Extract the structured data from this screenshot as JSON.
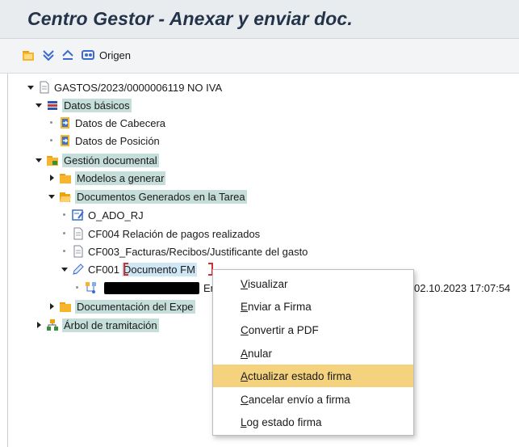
{
  "header": {
    "title": "Centro Gestor - Anexar y enviar doc."
  },
  "toolbar": {
    "origin_label": "Origen"
  },
  "tree": {
    "root": "GASTOS/2023/0000006119 NO IVA",
    "datos_basicos": "Datos básicos",
    "datos_cabecera": "Datos de Cabecera",
    "datos_posicion": "Datos de Posición",
    "gestion_documental": "Gestión documental",
    "modelos": "Modelos a generar",
    "documentos_generados": "Documentos Generados en la Tarea",
    "o_ado": "O_ADO_RJ",
    "cf004": "CF004 Relación de pagos realizados",
    "cf003": "CF003_Facturas/Recibos/Justificante del gasto",
    "cf001_code": "CF001",
    "cf001_name": "Documento FM",
    "child_prefix": "En",
    "child_date": "02.10.2023 17:07:54",
    "documentacion": "Documentación del Expe",
    "arbol": "Árbol de tramitación"
  },
  "context_menu": {
    "items": [
      {
        "first": "V",
        "rest": "isualizar"
      },
      {
        "first": "E",
        "rest": "nviar a Firma"
      },
      {
        "first": "C",
        "rest": "onvertir a PDF"
      },
      {
        "first": "A",
        "rest": "nular"
      },
      {
        "first": "A",
        "rest": "ctualizar estado firma"
      },
      {
        "first": "C",
        "rest": "ancelar envío a firma"
      },
      {
        "first": "L",
        "rest": "og estado firma"
      }
    ],
    "active_index": 4
  },
  "colors": {
    "highlight_node": "#c5ded9",
    "menu_active": "#f5d37e",
    "title": "#233349",
    "focus_mark": "#d32f2f"
  },
  "icons": [
    "folder-orange-icon",
    "expand-all-icon",
    "collapse-all-icon",
    "origin-icon",
    "document-icon",
    "stack-icon",
    "doc-arrow-icon",
    "folder-icon",
    "open-folder-icon",
    "edit-doc-icon",
    "pen-icon",
    "user-tree-icon"
  ]
}
